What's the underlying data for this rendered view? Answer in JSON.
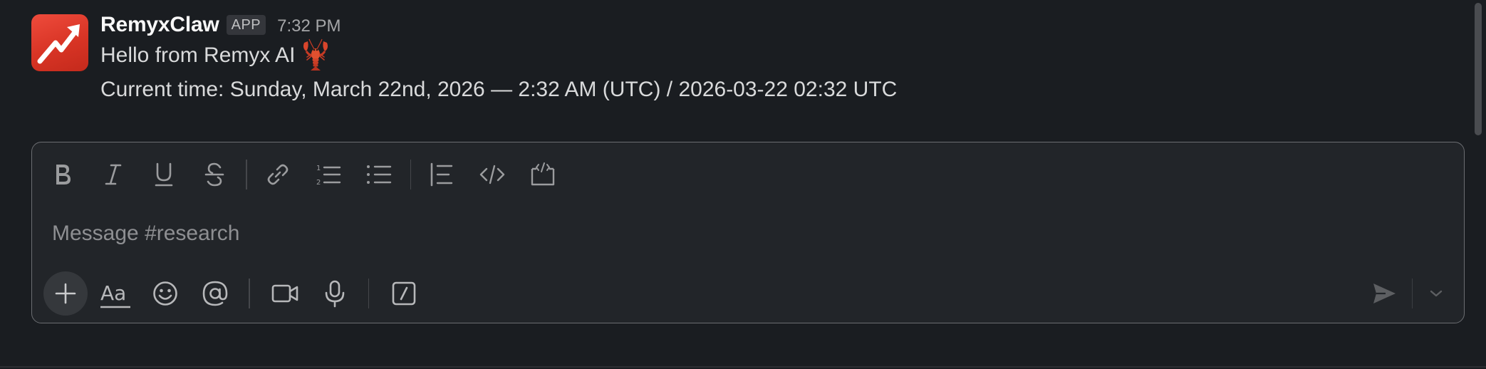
{
  "message": {
    "author": "RemyxClaw",
    "badge": "APP",
    "time": "7:32 PM",
    "lines": [
      "Hello from Remyx AI",
      "Current time: Sunday, March 22nd, 2026 — 2:32 AM (UTC) / 2026-03-22 02:32 UTC"
    ],
    "emoji": "lobster-emoji"
  },
  "composer": {
    "placeholder": "Message #research",
    "format_toolbar": [
      "bold-icon",
      "italic-icon",
      "underline-icon",
      "strikethrough-icon",
      "link-icon",
      "ordered-list-icon",
      "bulleted-list-icon",
      "blockquote-icon",
      "code-icon",
      "code-block-icon"
    ],
    "action_bar": [
      "plus-icon",
      "text-format-icon",
      "emoji-icon",
      "mention-icon",
      "video-icon",
      "microphone-icon",
      "shortcuts-icon"
    ],
    "send": [
      "send-icon",
      "chevron-down-icon"
    ]
  },
  "colors": {
    "background": "#1a1d21",
    "composer_background": "#222529",
    "avatar": "#e23b2c",
    "author_text": "#f8f8f8",
    "body_text": "#d9dadb",
    "muted_text": "#8e8f92"
  }
}
